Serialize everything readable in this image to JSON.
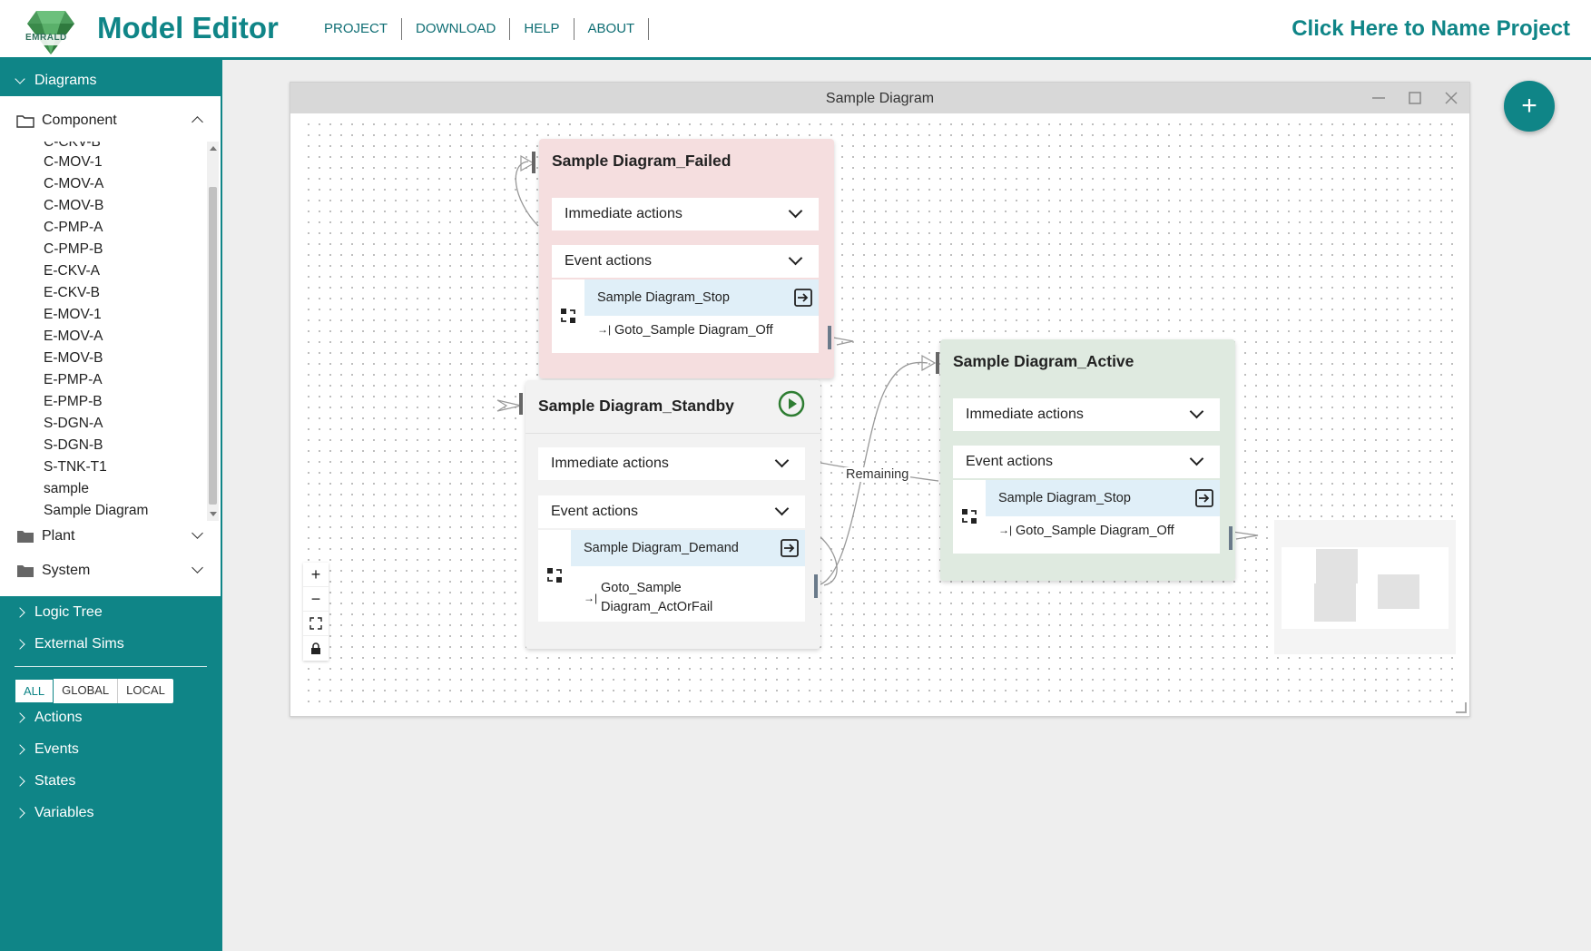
{
  "header": {
    "title": "Model Editor",
    "logo_text": "EMRALD",
    "nav": [
      "PROJECT",
      "DOWNLOAD",
      "HELP",
      "ABOUT"
    ],
    "project_name": "Click Here to Name Project"
  },
  "sidebar": {
    "diagrams_label": "Diagrams",
    "folders": {
      "component": "Component",
      "plant": "Plant",
      "system": "System"
    },
    "component_items": [
      "C-CKV-B",
      "C-MOV-1",
      "C-MOV-A",
      "C-MOV-B",
      "C-PMP-A",
      "C-PMP-B",
      "E-CKV-A",
      "E-CKV-B",
      "E-MOV-1",
      "E-MOV-A",
      "E-MOV-B",
      "E-PMP-A",
      "E-PMP-B",
      "S-DGN-A",
      "S-DGN-B",
      "S-TNK-T1",
      "sample",
      "Sample Diagram"
    ],
    "logic_tree": "Logic Tree",
    "external_sims": "External Sims",
    "filters": [
      "ALL",
      "GLOBAL",
      "LOCAL"
    ],
    "sections": [
      "Actions",
      "Events",
      "States",
      "Variables"
    ]
  },
  "window": {
    "title": "Sample Diagram"
  },
  "nodes": {
    "failed": {
      "title": "Sample Diagram_Failed",
      "immediate": "Immediate actions",
      "event": "Event actions",
      "event_name": "Sample Diagram_Stop",
      "action": "Goto_Sample Diagram_Off"
    },
    "standby": {
      "title": "Sample Diagram_Standby",
      "immediate": "Immediate actions",
      "event": "Event actions",
      "event_name": "Sample Diagram_Demand",
      "action_line1": "Goto_Sample",
      "action_line2": "Diagram_ActOrFail"
    },
    "active": {
      "title": "Sample Diagram_Active",
      "immediate": "Immediate actions",
      "event": "Event actions",
      "event_name": "Sample Diagram_Stop",
      "action": "Goto_Sample Diagram_Off"
    }
  },
  "edge_label": "Remaining",
  "zoom_controls": [
    "+",
    "−"
  ],
  "fab": "+",
  "colors": {
    "brand": "#0f8587",
    "failed_bg": "#f5dedf",
    "active_bg": "#dfeae0",
    "standby_bg": "#f2f2f2",
    "event_name_bg": "#e0eff8",
    "play_green": "#2e7d32"
  },
  "icons": [
    "logo-gem-icon",
    "folder-icon",
    "chevron-icon",
    "swap-icon",
    "exit-icon",
    "goto-icon",
    "play-icon",
    "plus-icon",
    "fit-screen-icon",
    "lock-icon",
    "minimize-icon",
    "maximize-icon",
    "close-icon"
  ]
}
